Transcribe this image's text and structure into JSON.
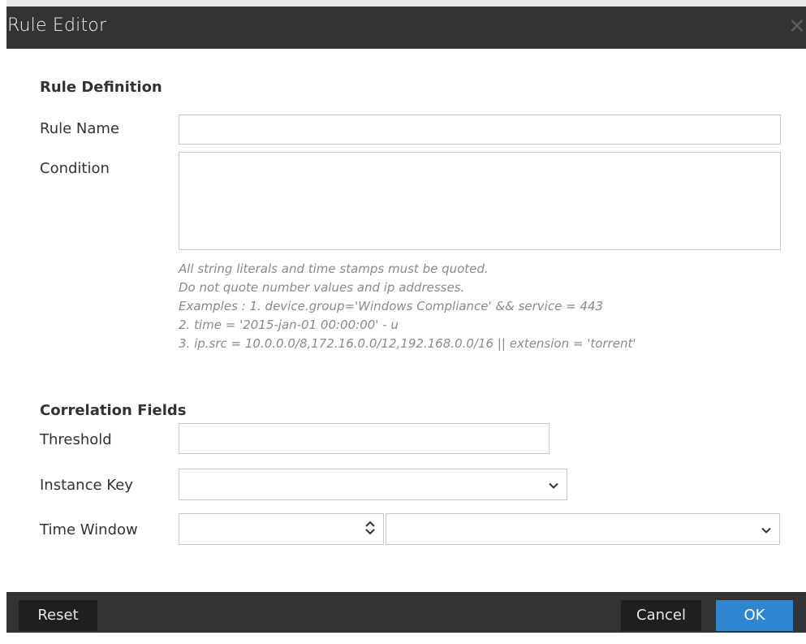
{
  "dialog": {
    "title": "Rule Editor",
    "close_glyph": "✕"
  },
  "rule_definition": {
    "heading": "Rule Definition",
    "rule_name_label": "Rule Name",
    "rule_name_value": "",
    "condition_label": "Condition",
    "condition_value": "",
    "hints": [
      "All string literals and time stamps must be quoted.",
      "Do not quote number values and ip addresses.",
      "Examples : 1. device.group='Windows Compliance' && service = 443",
      "2. time = '2015-jan-01 00:00:00' - u",
      "3. ip.src = 10.0.0.0/8,172.16.0.0/12,192.168.0.0/16 || extension = 'torrent'"
    ]
  },
  "correlation_fields": {
    "heading": "Correlation Fields",
    "threshold_label": "Threshold",
    "threshold_value": "",
    "instance_key_label": "Instance Key",
    "instance_key_value": "",
    "time_window_label": "Time Window",
    "time_window_value": "",
    "time_window_unit": ""
  },
  "footer": {
    "reset_label": "Reset",
    "cancel_label": "Cancel",
    "ok_label": "OK"
  },
  "colors": {
    "titlebar": "#333333",
    "ok_button": "#2e86d0",
    "dark_button": "#1f1f1f"
  }
}
